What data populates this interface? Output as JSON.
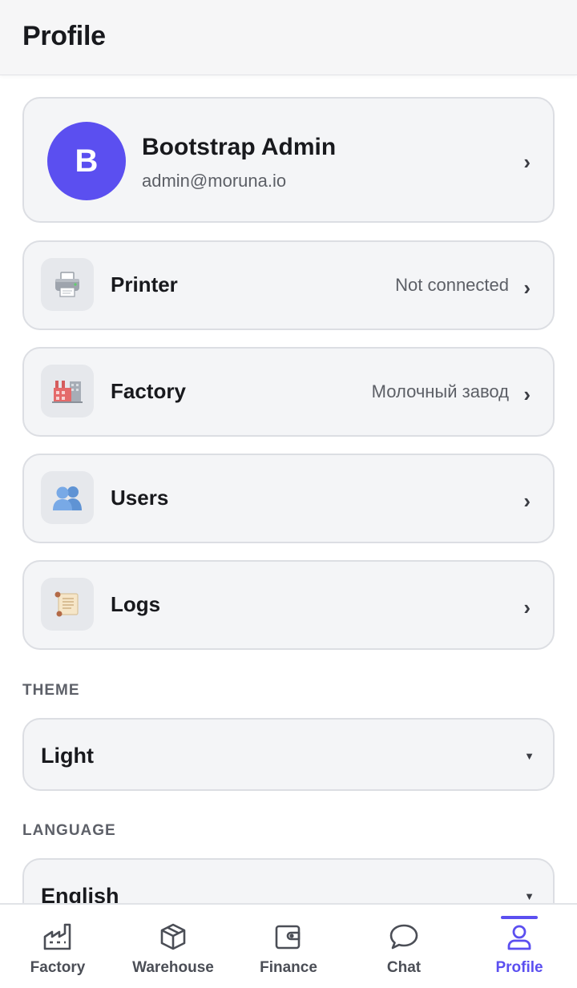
{
  "header": {
    "title": "Profile"
  },
  "user": {
    "initial": "B",
    "name": "Bootstrap Admin",
    "email": "admin@moruna.io"
  },
  "rows": [
    {
      "label": "Printer",
      "value": "Not connected",
      "icon": "printer-icon"
    },
    {
      "label": "Factory",
      "value": "Молочный завод",
      "icon": "factory-icon"
    },
    {
      "label": "Users",
      "value": "",
      "icon": "users-icon"
    },
    {
      "label": "Logs",
      "value": "",
      "icon": "scroll-icon"
    }
  ],
  "theme": {
    "label": "THEME",
    "value": "Light"
  },
  "language": {
    "label": "LANGUAGE",
    "value": "English"
  },
  "chevron": "›",
  "caret": "▼",
  "tabs": [
    {
      "label": "Factory",
      "icon": "factory-icon",
      "active": false
    },
    {
      "label": "Warehouse",
      "icon": "box-icon",
      "active": false
    },
    {
      "label": "Finance",
      "icon": "wallet-icon",
      "active": false
    },
    {
      "label": "Chat",
      "icon": "chat-bubble-icon",
      "active": false
    },
    {
      "label": "Profile",
      "icon": "person-icon",
      "active": true
    }
  ],
  "colors": {
    "accent": "#5b4ff0",
    "card_bg": "#f4f5f7",
    "card_border": "#dcdee3"
  }
}
